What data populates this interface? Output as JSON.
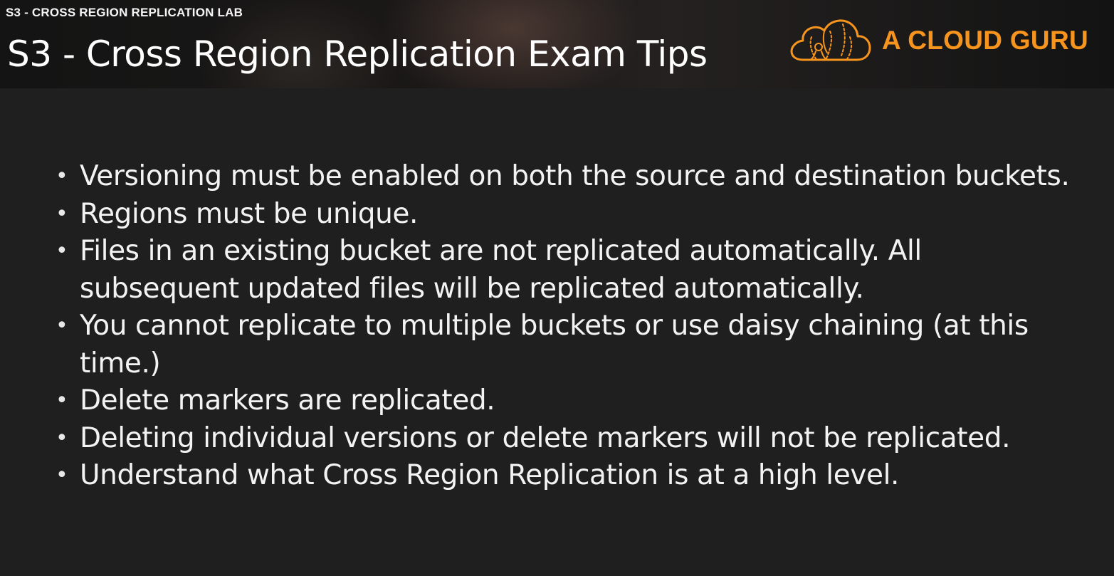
{
  "header": {
    "lab_label": "S3 - CROSS REGION REPLICATION LAB",
    "title": "S3 - Cross Region Replication Exam Tips",
    "logo": {
      "text": "A CLOUD GURU",
      "icon": "cloud-guru-logo-icon",
      "color": "#f7941d"
    }
  },
  "tips": [
    "Versioning must be enabled on both the source and destination buckets.",
    "Regions must be unique.",
    "Files in an existing bucket are not replicated automatically. All subsequent updated files will be replicated automatically.",
    "You cannot replicate to multiple buckets or use daisy chaining (at this time.)",
    "Delete markers are replicated.",
    "Deleting individual versions or delete markers will not be replicated.",
    "Understand what Cross Region Replication is at a high level."
  ],
  "bullet_glyph": "•",
  "colors": {
    "background": "#1f1f1f",
    "text": "#f3f3f3",
    "accent": "#f7941d"
  }
}
